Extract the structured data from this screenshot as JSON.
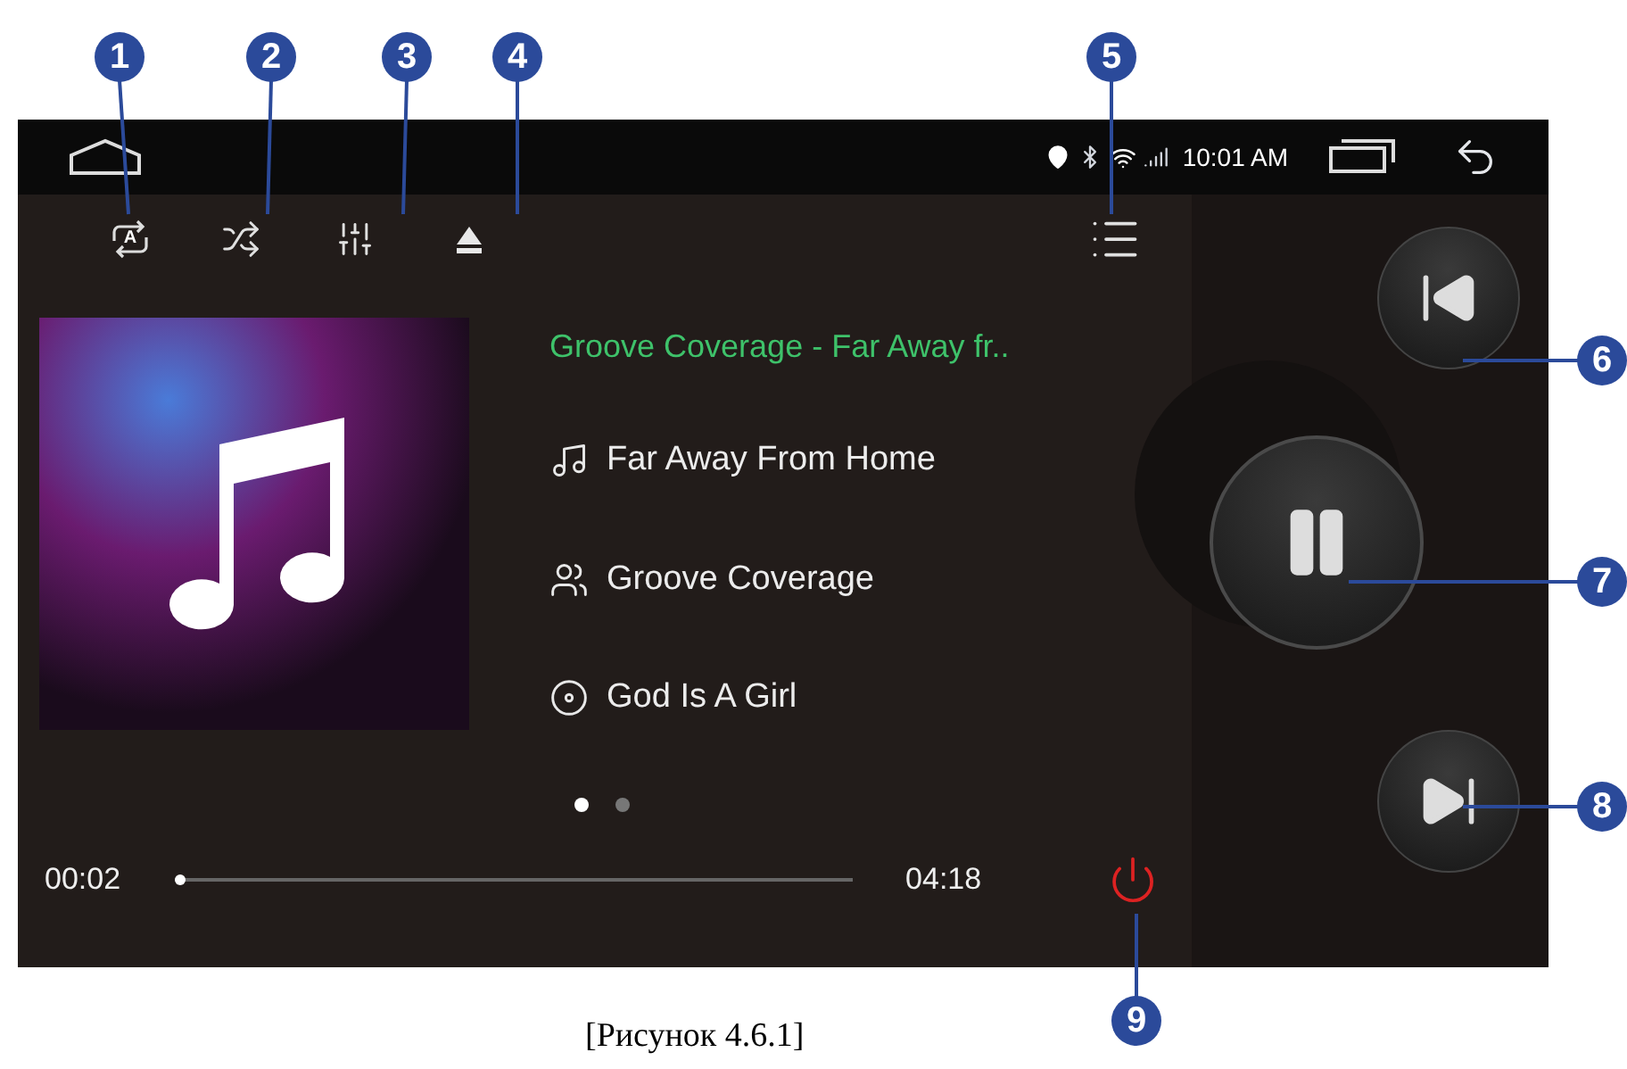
{
  "status_bar": {
    "time": "10:01 AM"
  },
  "player": {
    "title": "Groove Coverage - Far Away fr..",
    "track_rows": [
      {
        "kind": "song",
        "text": "Far Away From Home"
      },
      {
        "kind": "artist",
        "text": "Groove Coverage"
      },
      {
        "kind": "album",
        "text": "God Is A Girl"
      }
    ],
    "pages": [
      {
        "selected": true
      },
      {
        "selected": false
      }
    ],
    "repeat_mode": "A",
    "elapsed": "00:02",
    "total": "04:18",
    "progress": {
      "level": 0.01
    },
    "playing": true
  },
  "callouts": [
    {
      "number": "1"
    },
    {
      "number": "2"
    },
    {
      "number": "3"
    },
    {
      "number": "4"
    },
    {
      "number": "5"
    },
    {
      "number": "6"
    },
    {
      "number": "7"
    },
    {
      "number": "8"
    },
    {
      "number": "9"
    }
  ],
  "caption": "[Рисунок 4.6.1]"
}
